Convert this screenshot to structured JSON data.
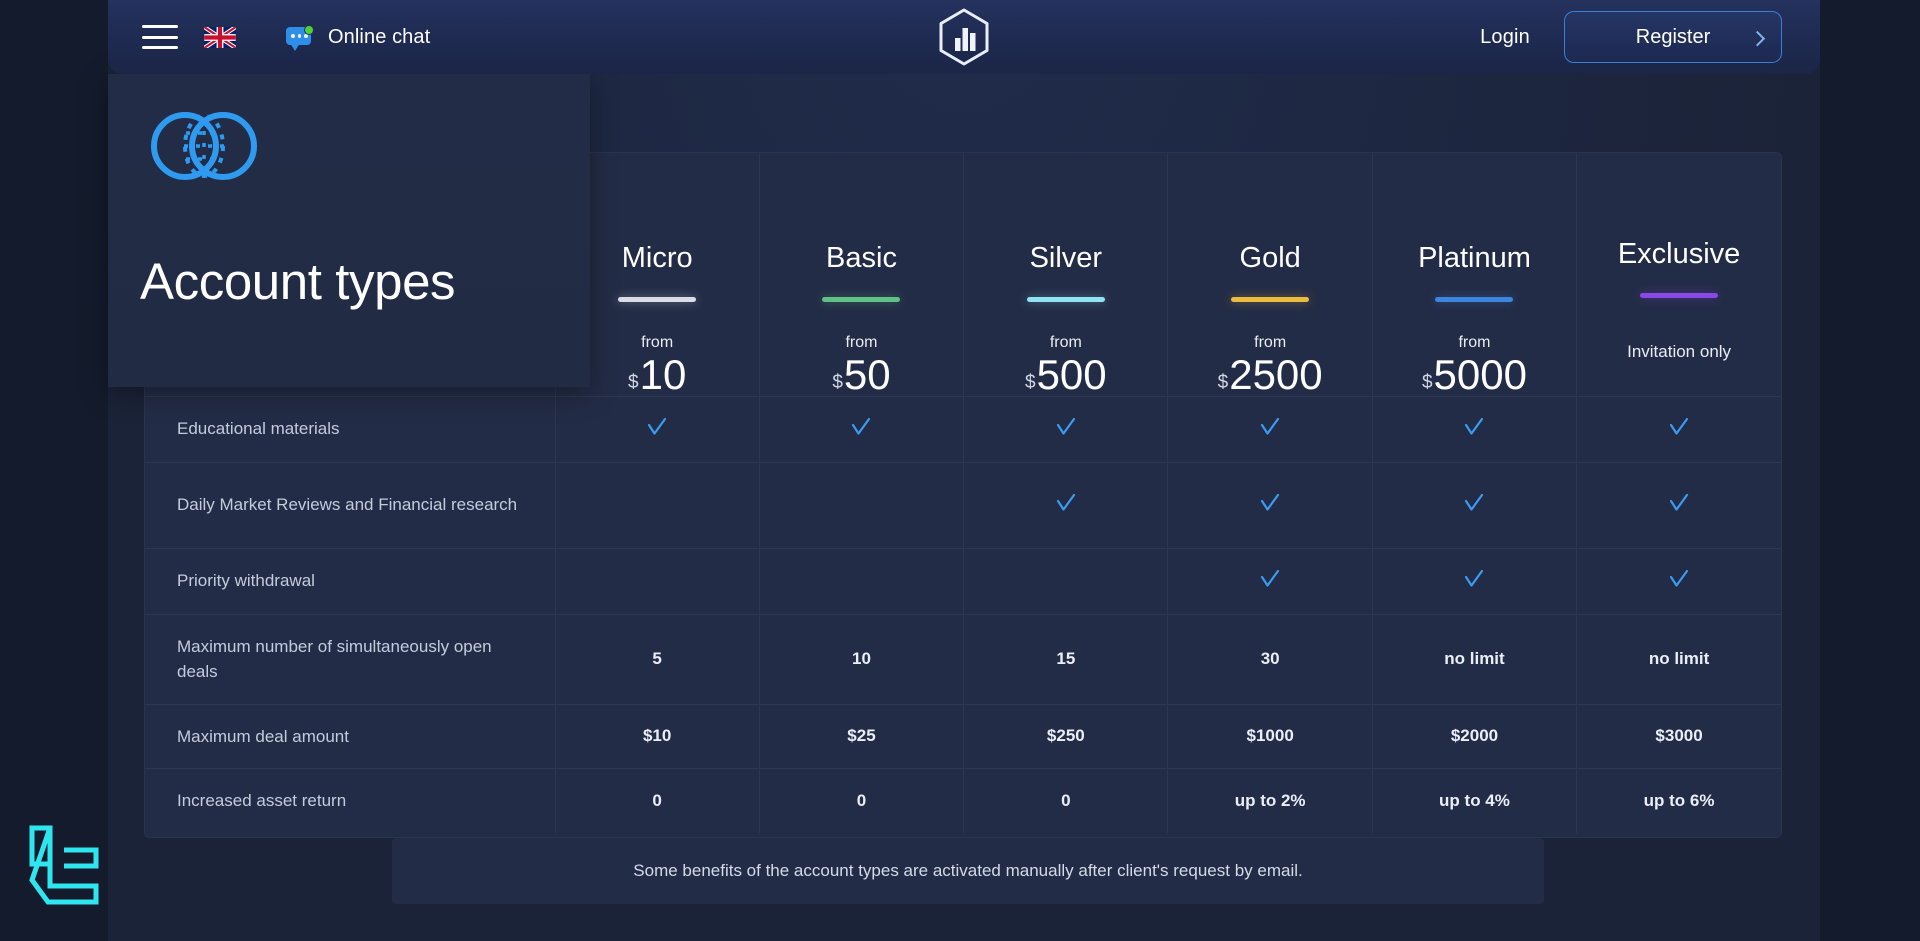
{
  "header": {
    "menu_icon": "hamburger-menu-icon",
    "language_flag": "uk-flag-icon",
    "chat_label": "Online chat",
    "brand_icon": "hexagon-chart-logo-icon",
    "login_label": "Login",
    "register_label": "Register",
    "register_chevron": "chevron-right-icon"
  },
  "overlay": {
    "logo_icon": "overlapping-circles-logo-icon",
    "title": "Account types"
  },
  "plans": [
    {
      "name": "Micro",
      "accent": "#d8dde6",
      "from_label": "from",
      "currency": "$",
      "price": "10",
      "invite": ""
    },
    {
      "name": "Basic",
      "accent": "#5fc184",
      "from_label": "from",
      "currency": "$",
      "price": "50",
      "invite": ""
    },
    {
      "name": "Silver",
      "accent": "#8fe3f2",
      "from_label": "from",
      "currency": "$",
      "price": "500",
      "invite": ""
    },
    {
      "name": "Gold",
      "accent": "#edbc3e",
      "from_label": "from",
      "currency": "$",
      "price": "2500",
      "invite": ""
    },
    {
      "name": "Platinum",
      "accent": "#3d86e0",
      "from_label": "from",
      "currency": "$",
      "price": "5000",
      "invite": ""
    },
    {
      "name": "Exclusive",
      "accent": "#8b48e8",
      "from_label": "",
      "currency": "",
      "price": "",
      "invite": "Invitation only"
    }
  ],
  "rows": [
    {
      "feature": "Educational materials",
      "values": [
        "check",
        "check",
        "check",
        "check",
        "check",
        "check"
      ]
    },
    {
      "feature": "Daily Market Reviews and Financial research",
      "values": [
        "",
        "",
        "check",
        "check",
        "check",
        "check"
      ]
    },
    {
      "feature": "Priority withdrawal",
      "values": [
        "",
        "",
        "",
        "check",
        "check",
        "check"
      ]
    },
    {
      "feature": "Maximum number of simultaneously open deals",
      "values": [
        "5",
        "10",
        "15",
        "30",
        "no limit",
        "no limit"
      ]
    },
    {
      "feature": "Maximum deal amount",
      "values": [
        "$10",
        "$25",
        "$250",
        "$1000",
        "$2000",
        "$3000"
      ]
    },
    {
      "feature": "Increased asset return",
      "values": [
        "0",
        "0",
        "0",
        "up to 2%",
        "up to 4%",
        "up to 6%"
      ]
    }
  ],
  "note": "Some benefits of the account types are activated manually after client's request by email.",
  "watermark": {
    "icon": "lc-monogram-watermark-icon",
    "color": "#2ee6f0"
  },
  "colors": {
    "page_bg": "#141b2c",
    "content_bg": "#1b2338",
    "card_bg": "#232c46",
    "header_bg": "#24325e",
    "accent_blue": "#3d86e0",
    "check_blue": "#3b9bf0"
  }
}
